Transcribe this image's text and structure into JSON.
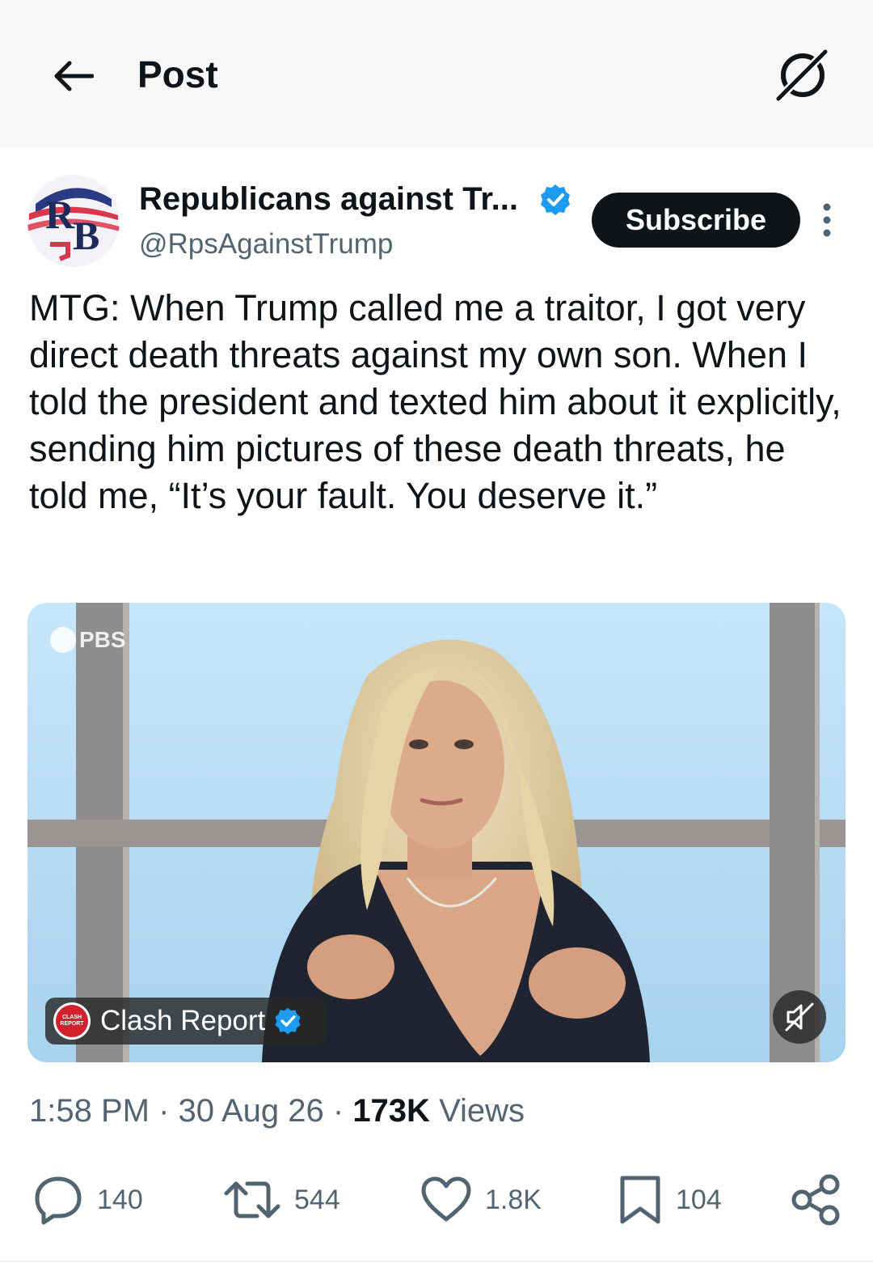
{
  "header": {
    "title": "Post",
    "back_icon": "arrow-left-icon",
    "grok_icon": "grok-icon"
  },
  "author": {
    "display_name": "Republicans against Tr...",
    "handle": "@RpsAgainstTrump",
    "avatar_letters": "RB",
    "verified": true,
    "subscribe_label": "Subscribe"
  },
  "post": {
    "text": "MTG: When Trump called me a traitor, I got very direct death threats against my own son. When I told the president and texted him about it explicitly, sending him pictures of these death threats, he told me, “It’s your fault. You deserve it.”"
  },
  "media": {
    "watermark": "PBS",
    "source_name": "Clash Report",
    "source_logo_text": "CLASH REPORT",
    "source_verified": true,
    "muted": true
  },
  "meta": {
    "time": "1:58 PM",
    "separator": "·",
    "date": "30 Aug 26",
    "views_count": "173K",
    "views_label": "Views"
  },
  "actions": {
    "replies": "140",
    "reposts": "544",
    "likes": "1.8K",
    "bookmarks": "104"
  },
  "colors": {
    "verified_blue": "#1d9bf0",
    "text_primary": "#0f1419",
    "text_secondary": "#536471",
    "subscribe_bg": "#0f1419"
  }
}
